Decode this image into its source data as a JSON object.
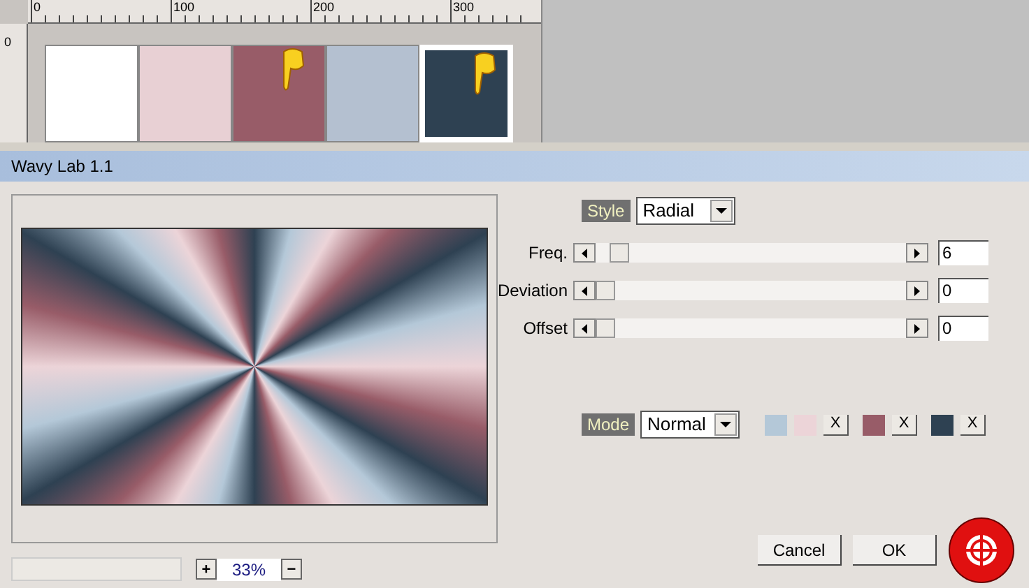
{
  "ruler": {
    "top_labels": [
      "0",
      "100",
      "200",
      "300"
    ],
    "left_label": "0"
  },
  "swatches": [
    {
      "color": "#ffffff",
      "selected": false,
      "pointer": false
    },
    {
      "color": "#e8d0d4",
      "selected": false,
      "pointer": false
    },
    {
      "color": "#985c68",
      "selected": false,
      "pointer": true
    },
    {
      "color": "#b4c0d0",
      "selected": false,
      "pointer": false
    },
    {
      "color": "#2e4152",
      "selected": true,
      "pointer": true
    }
  ],
  "window": {
    "title": "Wavy Lab 1.1"
  },
  "style": {
    "label": "Style",
    "value": "Radial"
  },
  "sliders": [
    {
      "label": "Freq.",
      "level": 0.05,
      "value": "6"
    },
    {
      "label": "Deviation",
      "level": 0,
      "value": "0"
    },
    {
      "label": "Offset",
      "level": 0,
      "value": "0"
    }
  ],
  "mode": {
    "label": "Mode",
    "value": "Normal"
  },
  "color_groups": [
    {
      "colors": [
        {
          "color": "#b4c8d8"
        },
        {
          "color": "#ecd4d8"
        }
      ],
      "button": "X"
    },
    {
      "colors": [
        {
          "color": "#985c68"
        }
      ],
      "button": "X"
    },
    {
      "colors": [
        {
          "color": "#2e4152"
        }
      ],
      "button": "X"
    }
  ],
  "zoom": {
    "plus": "+",
    "value": "33%",
    "minus": "−"
  },
  "buttons": [
    "Cancel",
    "OK"
  ]
}
